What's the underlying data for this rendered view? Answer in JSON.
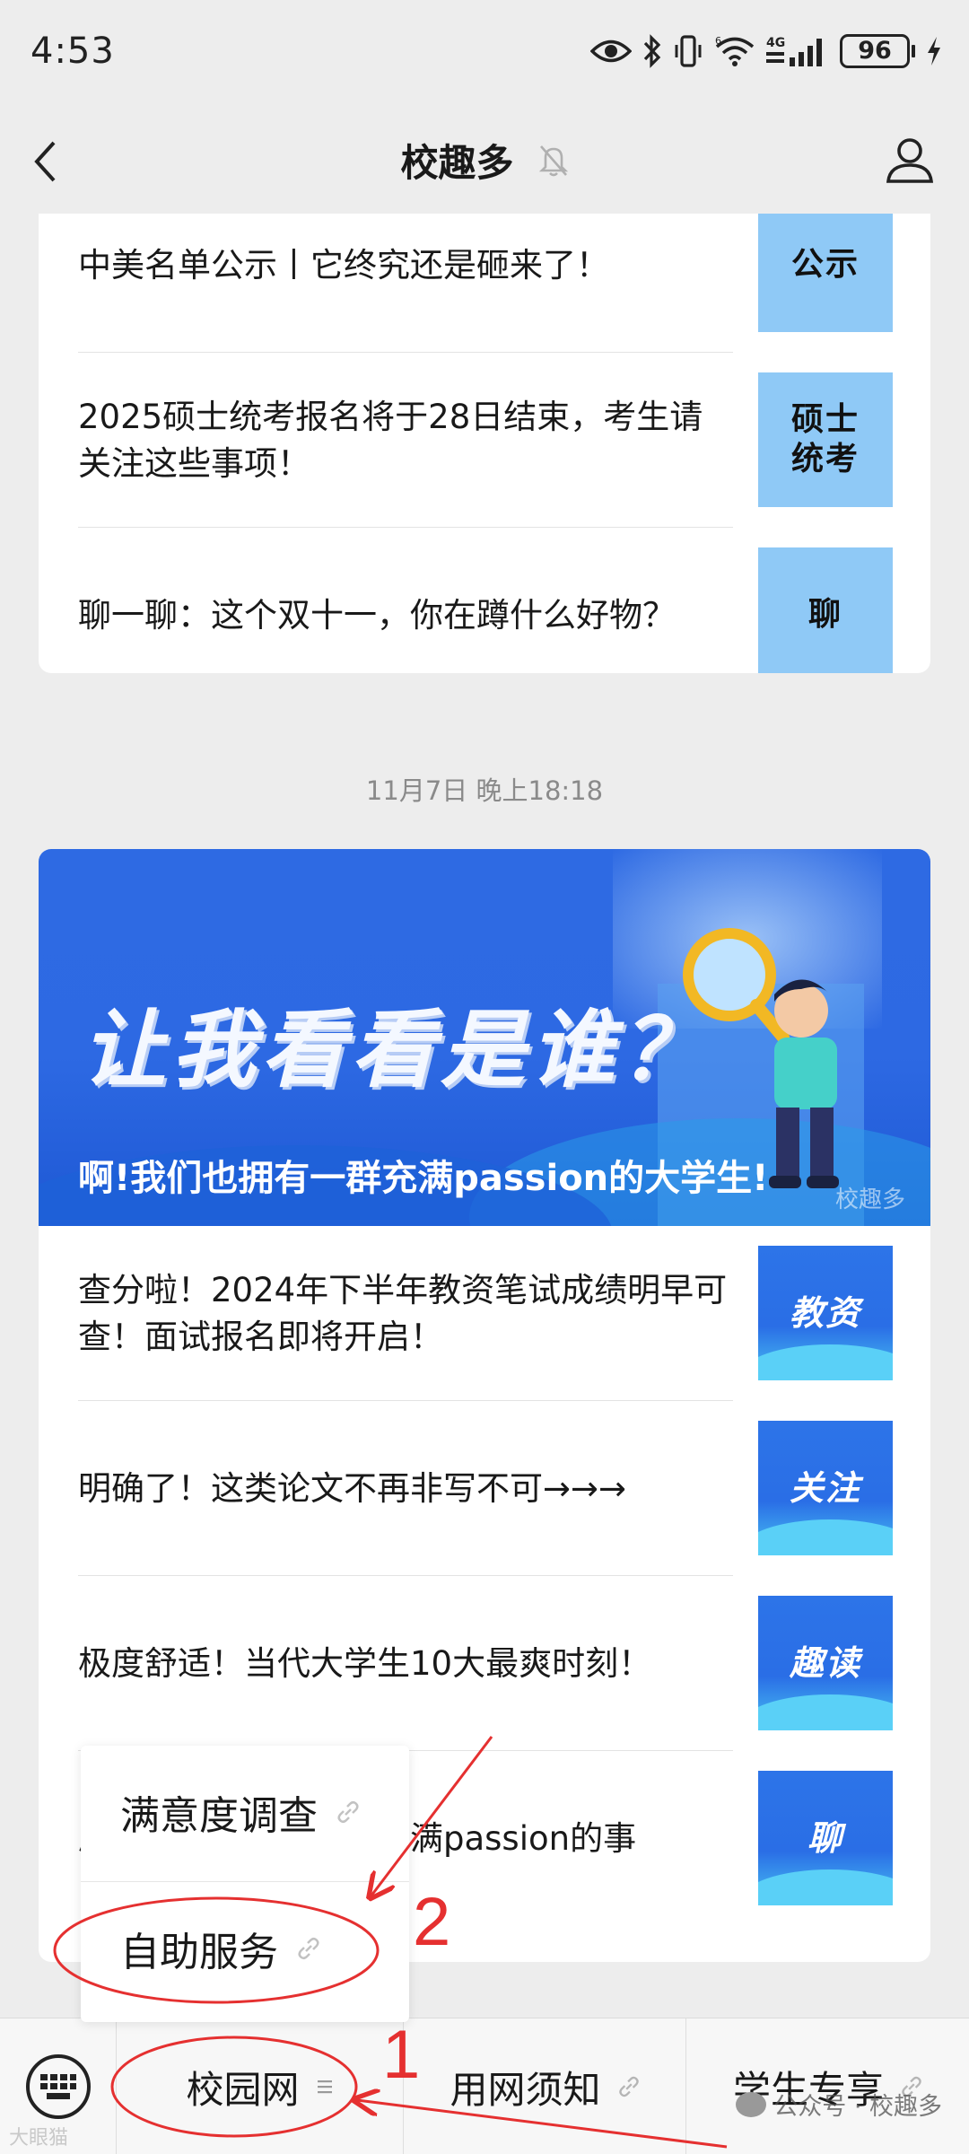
{
  "status_bar": {
    "time": "4:53",
    "battery": "96",
    "network_label": "4G",
    "sim_label": "6"
  },
  "nav": {
    "title": "校趣多"
  },
  "feed": {
    "card1_items": [
      {
        "title": "中美名单公示丨它终究还是砸来了！",
        "thumb_text": "公示"
      },
      {
        "title": "2025硕士统考报名将于28日结束，考生请关注这些事项！",
        "thumb_text": "硕士统考"
      },
      {
        "title": "聊一聊：这个双十一，你在蹲什么好物？",
        "thumb_text": "聊"
      }
    ],
    "timestamp": "11月7日 晚上18:18",
    "banner": {
      "headline": "让我看看是谁？",
      "subtitle": "啊!我们也拥有一群充满passion的大学生!",
      "watermark": "校趣多"
    },
    "card2_items": [
      {
        "title": "查分啦！2024年下半年教资笔试成绩明早可查！面试报名即将开启！",
        "thumb_text": "教资"
      },
      {
        "title": "明确了！这类论文不再非写不可→→→",
        "thumb_text": "关注"
      },
      {
        "title": "极度舒适！当代大学生10大最爽时刻！",
        "thumb_text": "趣读"
      },
      {
        "title": "原来大学生们都做过充满passion的事",
        "thumb_text": "聊"
      }
    ]
  },
  "popup_menu": {
    "items": [
      {
        "label": "满意度调查"
      },
      {
        "label": "自助服务"
      }
    ]
  },
  "bottom_menu": {
    "tabs": [
      {
        "label": "校园网"
      },
      {
        "label": "用网须知"
      },
      {
        "label": "学生专享"
      }
    ],
    "watermark": "公众号 · 校趣多",
    "corner_watermark": "大眼猫"
  },
  "annotations": {
    "step1": "1",
    "step2": "2",
    "color": "#e53030"
  }
}
